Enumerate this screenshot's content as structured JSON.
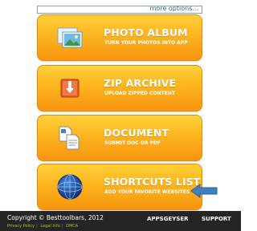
{
  "top_bar": {
    "more_options": "more options..."
  },
  "cards": [
    {
      "title": "PHOTO ALBUM",
      "subtitle": "TURN YOUR PHOTOS INTO APP",
      "icon": "photo-album-icon"
    },
    {
      "title": "ZIP ARCHIVE",
      "subtitle": "UPLOAD ZIPPED CONTENT",
      "icon": "zip-archive-icon"
    },
    {
      "title": "DOCUMENT",
      "subtitle": "SUBMIT DOC OR PDF",
      "icon": "document-icon"
    },
    {
      "title": "SHORTCUTS LIST",
      "subtitle": "ADD YOUR FAVORITE WEBSITES",
      "icon": "globe-icon"
    }
  ],
  "footer": {
    "copyright": "Copyright © Besttoolbars, 2012",
    "links": [
      "Privacy Policy",
      "Legal Info",
      "DMCA"
    ],
    "appsgeyser": "APPSGEYSER",
    "support": "SUPPORT"
  },
  "colors": {
    "card_top": "#fed13a",
    "card_bottom": "#f7950e",
    "footer_bg": "#252525",
    "link_green": "#9acd32",
    "arrow_blue": "#3f7fc4"
  }
}
